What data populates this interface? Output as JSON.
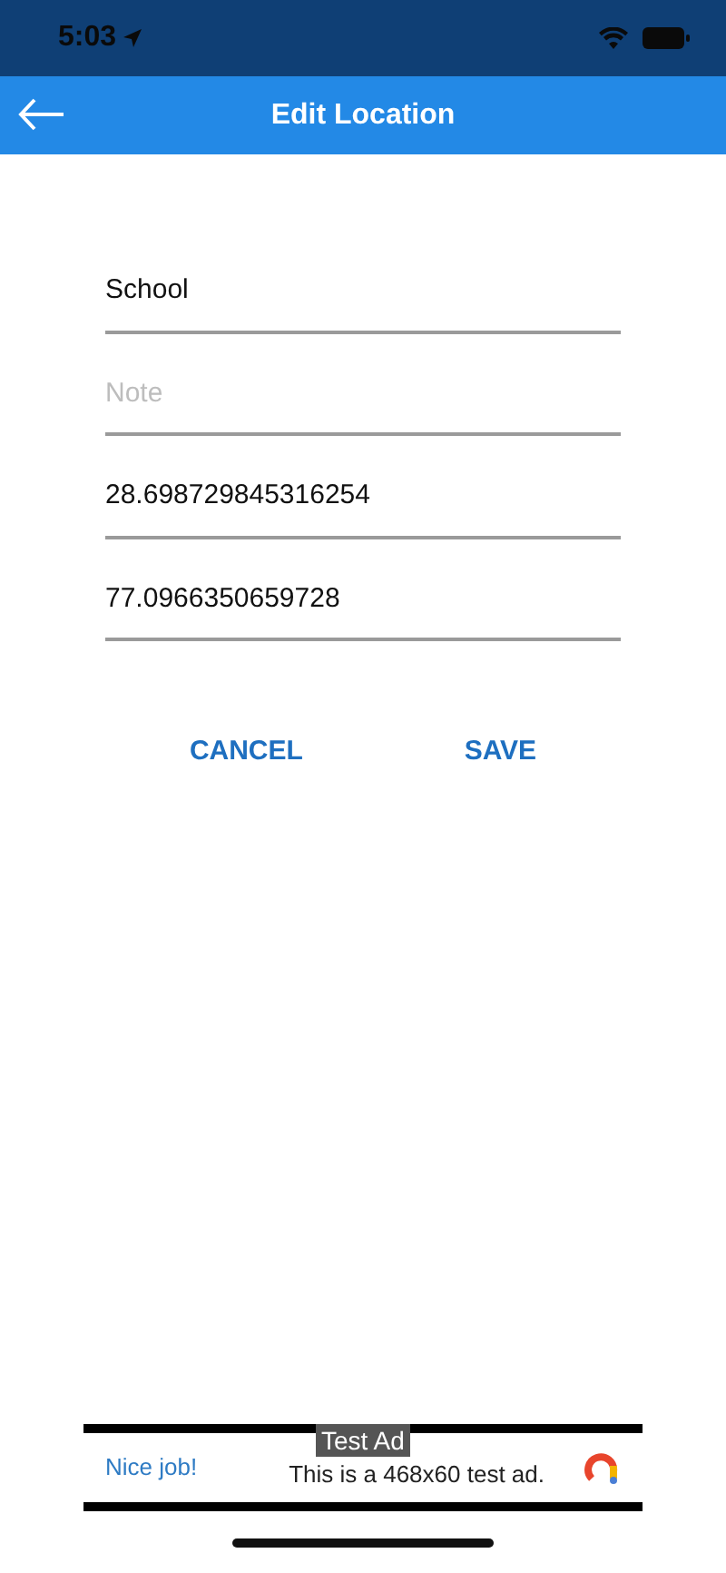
{
  "status_bar": {
    "time": "5:03"
  },
  "app_bar": {
    "title": "Edit Location"
  },
  "fields": [
    {
      "value": "School"
    },
    {
      "placeholder": "Note"
    },
    {
      "value": "28.698729845316254"
    },
    {
      "value": "77.0966350659728"
    }
  ],
  "buttons": [
    "CANCEL",
    "SAVE"
  ],
  "ad": {
    "label": "Test Ad",
    "headline": "Nice job!",
    "text": "This is a 468x60 test ad."
  }
}
